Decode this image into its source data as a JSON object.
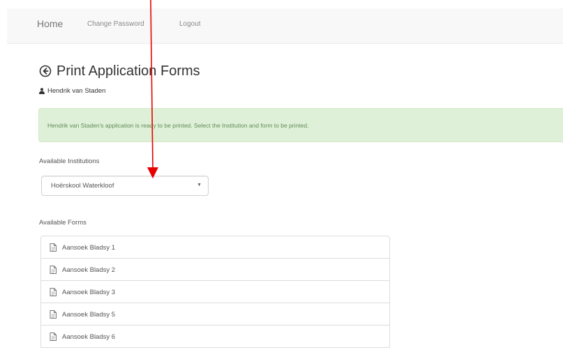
{
  "navbar": {
    "items": [
      {
        "label": "Home"
      },
      {
        "label": "Change Password"
      },
      {
        "label": "Logout"
      }
    ]
  },
  "header": {
    "title": "Print Application Forms",
    "title_icon": "circle-arrow-left-icon",
    "user_icon": "user-icon",
    "user_name": "Hendrik van Staden"
  },
  "alert": {
    "text": "Hendrik van Staden's application is ready to be printed. Select the Institution and form to be printed.",
    "background": "#dff0d8",
    "text_color": "#5e8c55"
  },
  "institutions": {
    "label": "Available Institutions",
    "selected": "Hoërskool Waterkloof",
    "caret_icon": "caret-down-icon"
  },
  "forms": {
    "label": "Available Forms",
    "item_icon": "file-icon",
    "items": [
      {
        "label": "Aansoek Bladsy 1"
      },
      {
        "label": "Aansoek Bladsy 2"
      },
      {
        "label": "Aansoek Bladsy 3"
      },
      {
        "label": "Aansoek Bladsy 5"
      },
      {
        "label": "Aansoek Bladsy 6"
      }
    ]
  },
  "annotation": {
    "arrow_color": "#e60000"
  }
}
